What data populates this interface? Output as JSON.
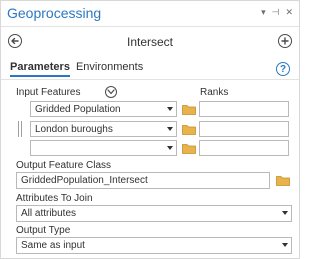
{
  "pane": {
    "title": "Geoprocessing",
    "controls": [
      "▾",
      "⊣",
      "✕"
    ]
  },
  "tool": {
    "title": "Intersect"
  },
  "tabs": [
    {
      "label": "Parameters",
      "active": true
    },
    {
      "label": "Environments",
      "active": false
    }
  ],
  "help": {
    "glyph": "?"
  },
  "input_features": {
    "label": "Input Features",
    "ranks_label": "Ranks",
    "rows": [
      {
        "value": "Gridded Population",
        "rank": ""
      },
      {
        "value": "London buroughs",
        "rank": ""
      },
      {
        "value": "",
        "rank": ""
      }
    ]
  },
  "output_feature_class": {
    "label": "Output Feature Class",
    "value": "GriddedPopulation_Intersect"
  },
  "attributes_to_join": {
    "label": "Attributes To Join",
    "value": "All attributes"
  },
  "output_type": {
    "label": "Output Type",
    "value": "Same as input"
  },
  "colors": {
    "accent": "#2b78c2",
    "folder": "#e8b34a"
  }
}
